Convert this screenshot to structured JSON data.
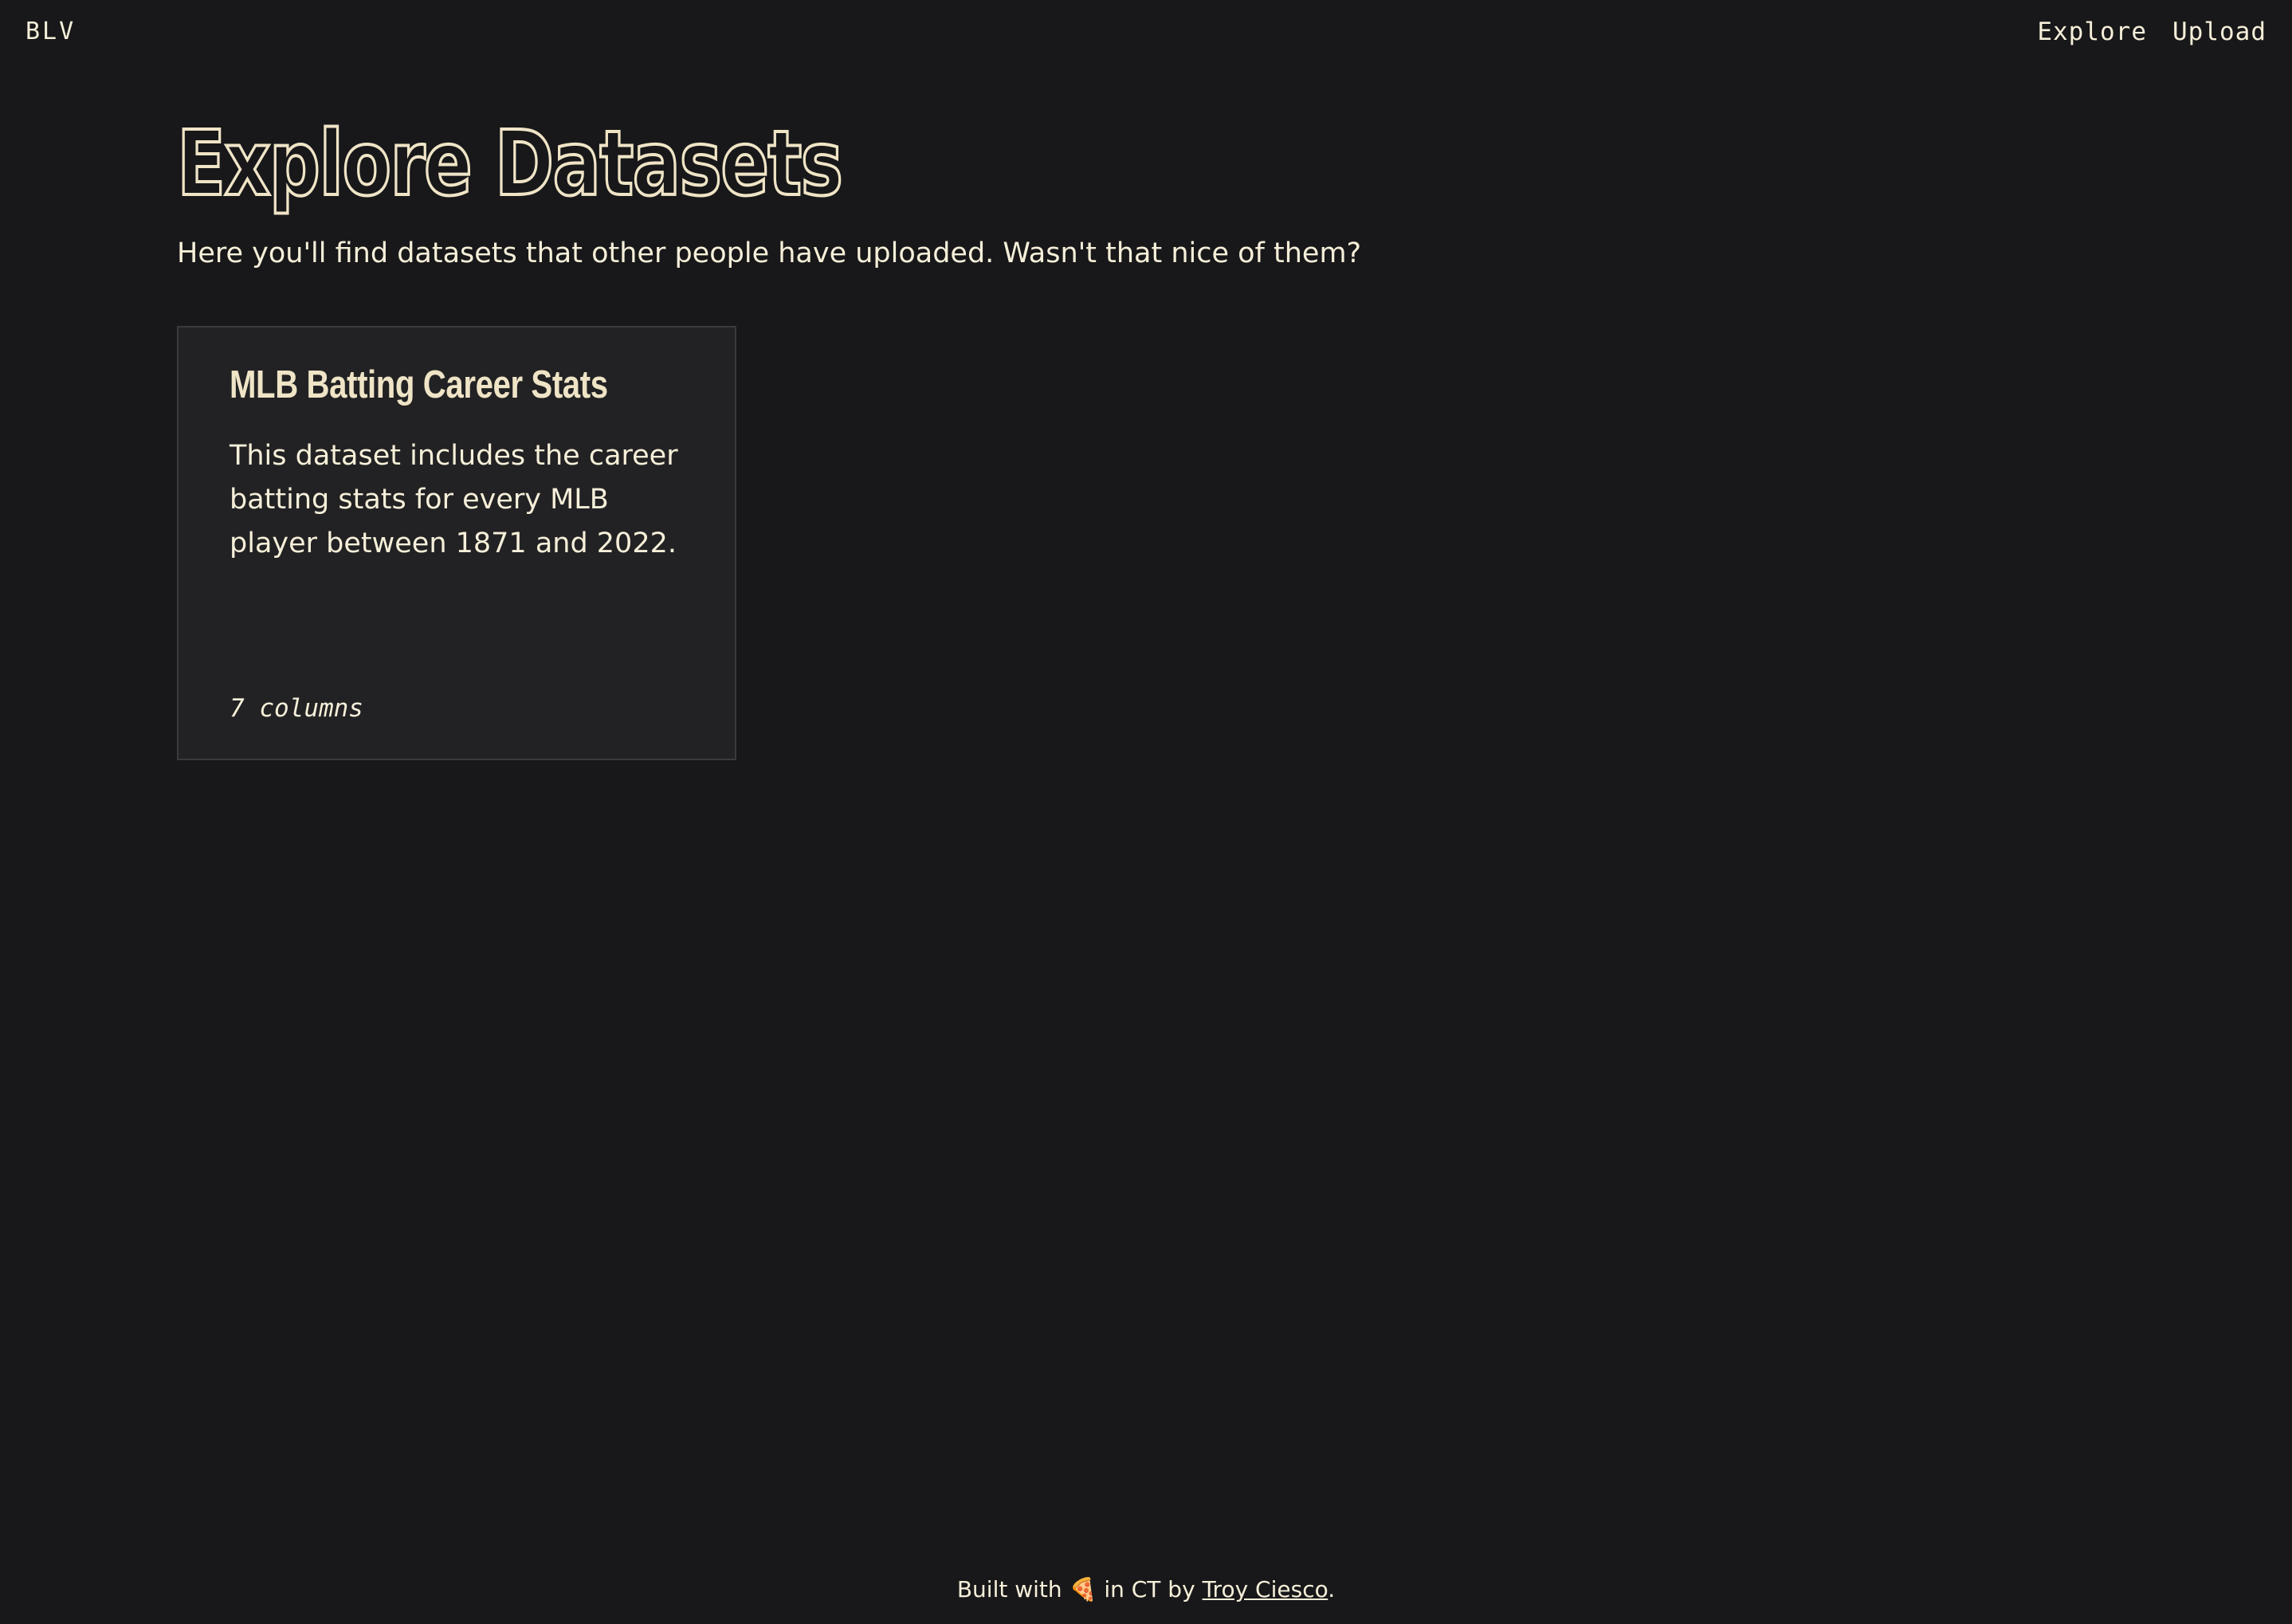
{
  "brand": "BLV",
  "nav": {
    "explore": "Explore",
    "upload": "Upload"
  },
  "page": {
    "title": "Explore Datasets",
    "intro": "Here you'll find datasets that other people have uploaded. Wasn't that nice of them?"
  },
  "datasets": [
    {
      "title": "MLB Batting Career Stats",
      "description": "This dataset includes the career batting stats for every MLB player between 1871 and 2022.",
      "meta": "7 columns"
    }
  ],
  "footer": {
    "prefix": "Built with",
    "icon": "pizza-icon",
    "icon_glyph": "🍕",
    "middle": "in CT by",
    "author": "Troy Ciesco",
    "suffix": "."
  }
}
